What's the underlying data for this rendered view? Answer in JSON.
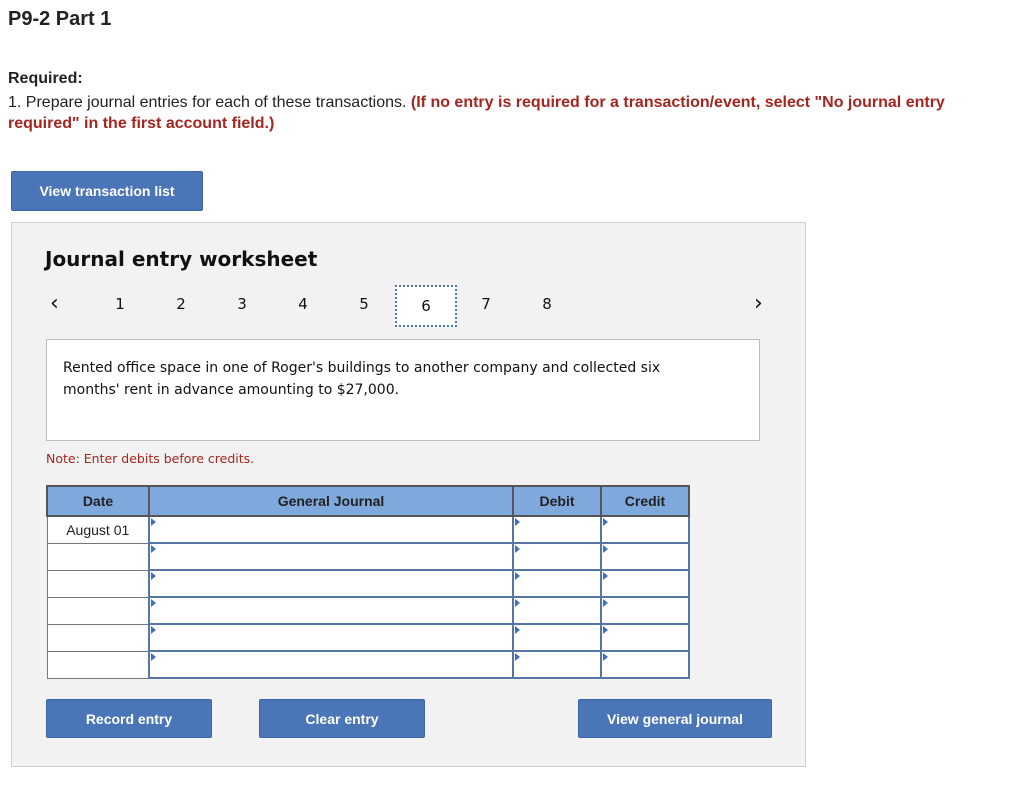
{
  "page": {
    "title": "P9-2 Part 1",
    "required_label": "Required:",
    "instruction_plain": "1. Prepare journal entries for each of these transactions. ",
    "instruction_red": "(If no entry is required for a transaction/event, select \"No journal entry required\" in the first account field.)",
    "view_transaction_list": "View transaction list"
  },
  "worksheet": {
    "title": "Journal entry worksheet",
    "pager": {
      "prev_icon": "chevron-left-icon",
      "next_icon": "chevron-right-icon",
      "pages": [
        "1",
        "2",
        "3",
        "4",
        "5",
        "6",
        "7",
        "8"
      ],
      "active_page": "6"
    },
    "description": "Rented office space in one of Roger's buildings to another company and collected six months' rent in advance amounting to $27,000.",
    "note": "Note: Enter debits before credits.",
    "table": {
      "headers": [
        "Date",
        "General Journal",
        "Debit",
        "Credit"
      ],
      "rows": [
        {
          "date": "August 01",
          "account": "",
          "debit": "",
          "credit": ""
        },
        {
          "date": "",
          "account": "",
          "debit": "",
          "credit": ""
        },
        {
          "date": "",
          "account": "",
          "debit": "",
          "credit": ""
        },
        {
          "date": "",
          "account": "",
          "debit": "",
          "credit": ""
        },
        {
          "date": "",
          "account": "",
          "debit": "",
          "credit": ""
        },
        {
          "date": "",
          "account": "",
          "debit": "",
          "credit": ""
        }
      ]
    },
    "buttons": {
      "record": "Record entry",
      "clear": "Clear entry",
      "view_general_journal": "View general journal"
    }
  },
  "colors": {
    "button_blue": "#4a76b8",
    "header_blue": "#7fa8dd",
    "instruction_red": "#a52520",
    "panel_bg": "#f2f2f2"
  }
}
